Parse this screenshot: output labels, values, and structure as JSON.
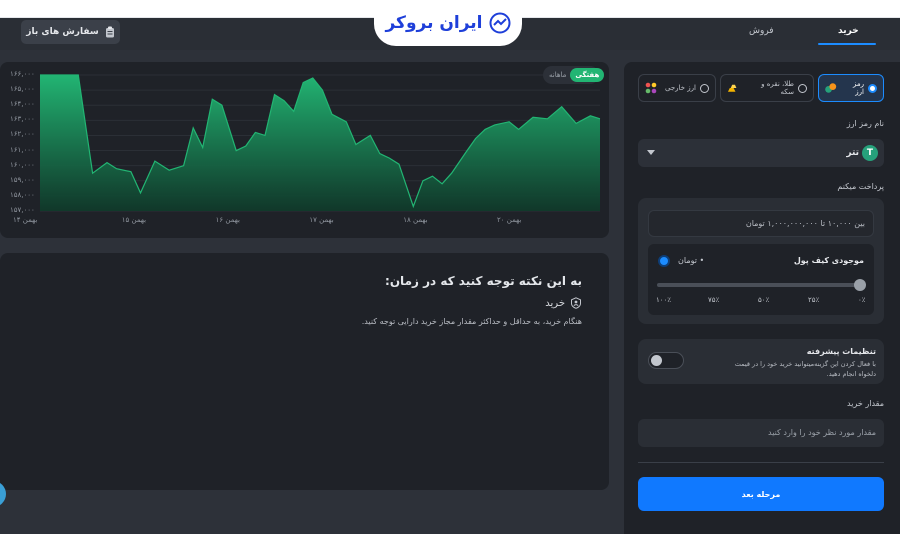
{
  "header": {
    "brand": "ایران بروکر",
    "open_orders": "سفارش های باز",
    "tabs": [
      {
        "label": "خرید",
        "active": true
      },
      {
        "label": "فروش",
        "active": false
      }
    ]
  },
  "chart": {
    "toggle": {
      "weekly": "هفتگی",
      "monthly": "ماهانه",
      "selected": "weekly"
    },
    "y_ticks": [
      "۱۶۶,۰۰۰",
      "۱۶۵,۰۰۰",
      "۱۶۴,۰۰۰",
      "۱۶۳,۰۰۰",
      "۱۶۲,۰۰۰",
      "۱۶۱,۰۰۰",
      "۱۶۰,۰۰۰",
      "۱۵۹,۰۰۰",
      "۱۵۸,۰۰۰",
      "۱۵۷,۰۰۰"
    ],
    "x_ticks": [
      "۱۴ بهمن",
      "۱۵ بهمن",
      "۱۶ بهمن",
      "۱۷ بهمن",
      "۱۸ بهمن",
      "۲۰ بهمن"
    ]
  },
  "chart_data": {
    "type": "area",
    "x_categories": [
      "۱۴ بهمن",
      "۱۵ بهمن",
      "۱۶ بهمن",
      "۱۷ بهمن",
      "۱۸ بهمن",
      "۲۰ بهمن"
    ],
    "ylim": [
      157000,
      166000
    ],
    "color": "#22b573",
    "series": [
      {
        "x": [
          0,
          0.2,
          0.4,
          0.55,
          0.7,
          0.8,
          0.95,
          1.05,
          1.2,
          1.35,
          1.5,
          1.6,
          1.7,
          1.8,
          1.9,
          2.05,
          2.15,
          2.25,
          2.35,
          2.45,
          2.55,
          2.65,
          2.75,
          2.85,
          2.95,
          3.05,
          3.2,
          3.3,
          3.45,
          3.55,
          3.65,
          3.75,
          3.9,
          4.0,
          4.1,
          4.2,
          4.3,
          4.45,
          4.55,
          4.65,
          4.75,
          4.9,
          5.0,
          5.15,
          5.3,
          5.45,
          5.6,
          5.75,
          5.85
        ],
        "values": [
          166000,
          166000,
          166000,
          159500,
          160200,
          159800,
          159600,
          158200,
          160300,
          159700,
          160000,
          162500,
          161200,
          164400,
          164000,
          161000,
          161300,
          162200,
          162000,
          164700,
          164300,
          163600,
          165500,
          165800,
          165000,
          163400,
          162900,
          161400,
          162000,
          160800,
          160500,
          160100,
          157300,
          159000,
          159300,
          158800,
          159500,
          160900,
          161800,
          162400,
          162700,
          162900,
          162400,
          163200,
          163100,
          163900,
          162800,
          163300,
          163100
        ]
      }
    ]
  },
  "note": {
    "title": "به این نکته توجه کنید که در زمان:",
    "item_title": "خرید",
    "item_text": "هنگام خرید، به حداقل و حداکثر مقدار مجاز خرید دارایی توجه کنید."
  },
  "order_form": {
    "asset_types": [
      {
        "label": "رمز ارز",
        "selected": true
      },
      {
        "label": "طلا، نقره و سکه",
        "selected": false
      },
      {
        "label": "ارز خارجی",
        "selected": false
      }
    ],
    "currency_label": "نام رمز ارز",
    "currency_value": "تتر",
    "pay_label": "پرداخت میکنم",
    "pay_placeholder": "بین ۱۰,۰۰۰ تا ۱,۰۰۰,۰۰۰,۰۰۰ تومان",
    "wallet_label": "موجودی کیف پول",
    "wallet_unit": "• تومان",
    "slider_ticks": [
      "۰٪",
      "۲۵٪",
      "۵۰٪",
      "۷۵٪",
      "۱۰۰٪"
    ],
    "advanced_title": "تنظیمات پیشرفته",
    "advanced_desc": "با فعال کردن این گزینه‌میتوانید خرید خود را در قیمت دلخواه انجام دهید.",
    "amount_label": "مقدار خرید",
    "amount_placeholder": "مقدار مورد نظر خود را وارد کنید",
    "next_button": "مرحله بعد"
  }
}
